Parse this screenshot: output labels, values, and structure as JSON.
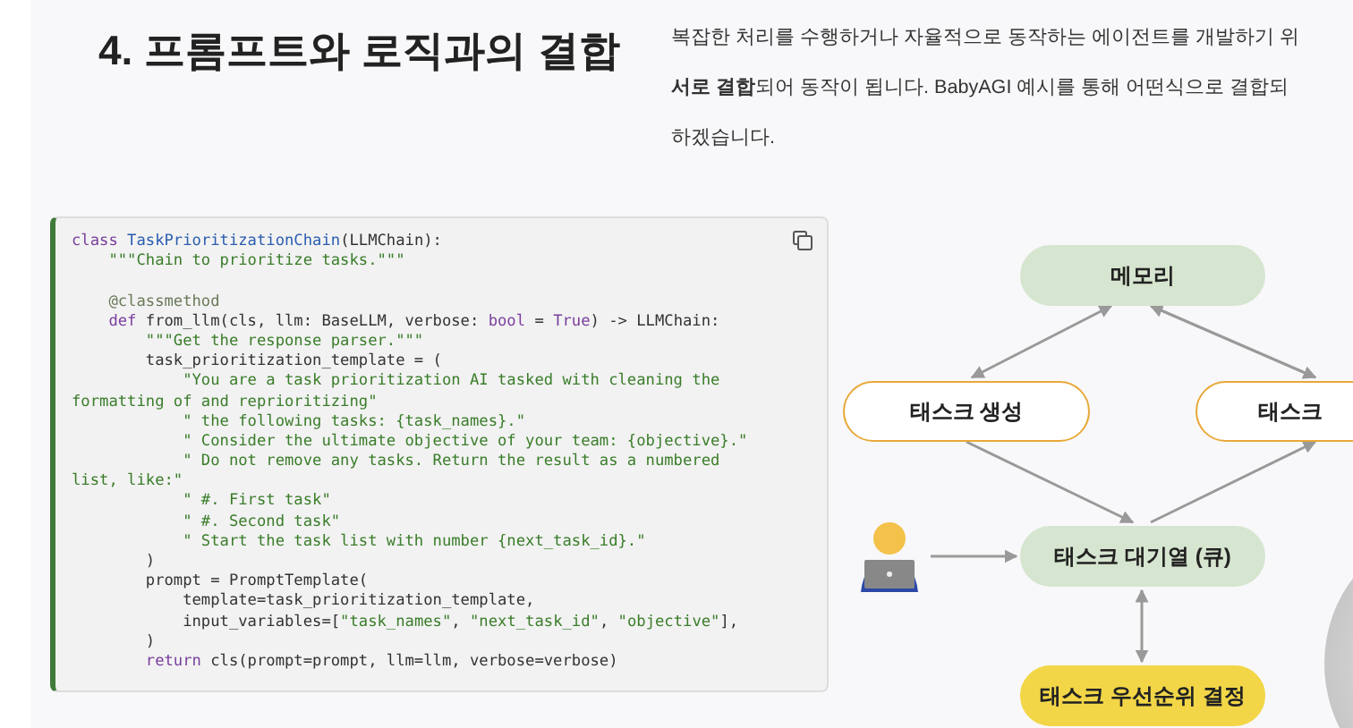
{
  "heading": "4. 프롬프트와 로직과의 결합",
  "intro": [
    "복잡한 처리를 수행하거나 자율적으로 동작하는 에이전트를 개발하기 위",
    "**서로 결합**되어 동작이 됩니다. BabyAGI 예시를 통해 어떤식으로 결합되",
    "하겠습니다."
  ],
  "code": [
    [
      {
        "kind": "keyword",
        "text": "class"
      },
      {
        "kind": "name",
        "text": " TaskPrioritizationChain"
      },
      {
        "kind": "plain",
        "text": "(LLMChain):"
      }
    ],
    [
      {
        "kind": "string",
        "text": "    \"\"\"Chain to prioritize tasks.\"\"\""
      }
    ],
    [
      {
        "kind": "blank"
      }
    ],
    [
      {
        "kind": "decorator",
        "text": "    @classmethod"
      }
    ],
    [
      {
        "kind": "keyword",
        "text": "    def"
      },
      {
        "kind": "plain",
        "text": " from_llm(cls, llm: BaseLLM, verbose: "
      },
      {
        "kind": "builtin",
        "text": "bool"
      },
      {
        "kind": "plain",
        "text": " = "
      },
      {
        "kind": "builtin",
        "text": "True"
      },
      {
        "kind": "plain",
        "text": ") -> LLMChain:"
      }
    ],
    [
      {
        "kind": "string",
        "text": "        \"\"\"Get the response parser.\"\"\""
      }
    ],
    [
      {
        "kind": "plain",
        "text": "        task_prioritization_template = ("
      }
    ],
    [
      {
        "kind": "string",
        "text": "            \"You are a task prioritization AI tasked with cleaning the"
      }
    ],
    [
      {
        "kind": "string",
        "text": "formatting of and reprioritizing\""
      }
    ],
    [
      {
        "kind": "string",
        "text": "            \" the following tasks: {task_names}.\""
      }
    ],
    [
      {
        "kind": "string",
        "text": "            \" Consider the ultimate objective of your team: {objective}.\""
      }
    ],
    [
      {
        "kind": "string",
        "text": "            \" Do not remove any tasks. Return the result as a numbered"
      }
    ],
    [
      {
        "kind": "string",
        "text": "list, like:\""
      }
    ],
    [
      {
        "kind": "string",
        "text": "            \" #. First task\""
      }
    ],
    [
      {
        "kind": "string",
        "text": "            \" #. Second task\""
      }
    ],
    [
      {
        "kind": "string",
        "text": "            \" Start the task list with number {next_task_id}.\""
      }
    ],
    [
      {
        "kind": "plain",
        "text": "        )"
      }
    ],
    [
      {
        "kind": "plain",
        "text": "        prompt = PromptTemplate("
      }
    ],
    [
      {
        "kind": "plain",
        "text": "            template=task_prioritization_template,"
      }
    ],
    [
      {
        "kind": "plain",
        "text": "            input_variables=["
      },
      {
        "kind": "string",
        "text": "\"task_names\""
      },
      {
        "kind": "plain",
        "text": ", "
      },
      {
        "kind": "string",
        "text": "\"next_task_id\""
      },
      {
        "kind": "plain",
        "text": ", "
      },
      {
        "kind": "string",
        "text": "\"objective\""
      },
      {
        "kind": "plain",
        "text": "],"
      }
    ],
    [
      {
        "kind": "plain",
        "text": "        )"
      }
    ],
    [
      {
        "kind": "keyword",
        "text": "        return"
      },
      {
        "kind": "plain",
        "text": " cls(prompt=prompt, llm=llm, verbose=verbose)"
      }
    ]
  ],
  "diagram": {
    "nodes": [
      {
        "label": "메모리",
        "kind": "store"
      },
      {
        "label": "태스크 생성",
        "kind": "step"
      },
      {
        "label": "태스크",
        "kind": "step"
      },
      {
        "label": "태스크 대기열 (큐)",
        "kind": "store"
      },
      {
        "label": "태스크 우선순위 결정",
        "kind": "priority"
      }
    ]
  }
}
